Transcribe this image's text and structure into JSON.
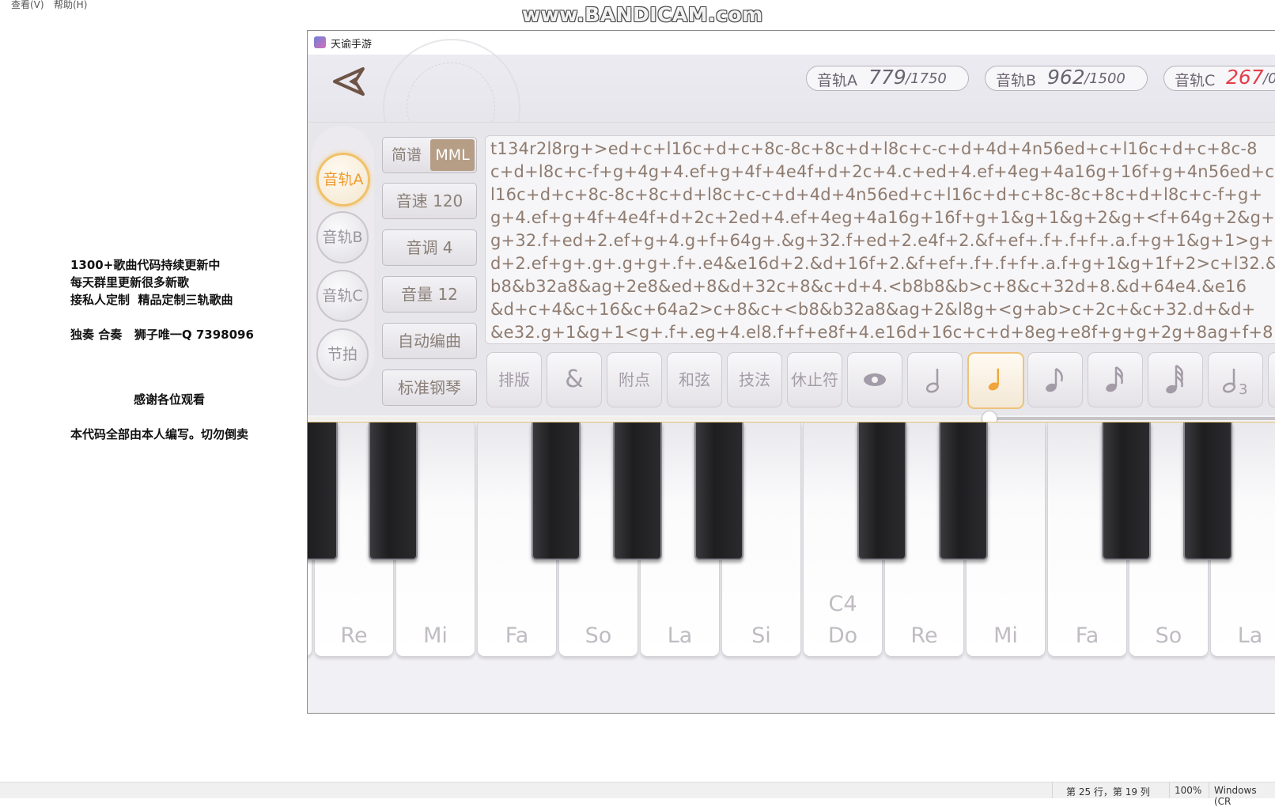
{
  "notepad": {
    "menu": [
      "查看(V)",
      "帮助(H)"
    ],
    "notes": {
      "line1": "1300+歌曲代码持续更新中",
      "line2": "每天群里更新很多新歌",
      "line3": "接私人定制  精品定制三轨歌曲",
      "line4": "独奏 合奏   狮子唯一Q 7398096",
      "line5": "感谢各位观看",
      "line6": "本代码全部由本人编写。切勿倒卖"
    },
    "status": {
      "position": "第 25 行，第 19 列",
      "zoom": "100%",
      "encoding": "Windows (CR"
    }
  },
  "watermark": "www.BANDICAM.com",
  "game": {
    "window_title": "天谕手游",
    "tracks": [
      {
        "label": "音轨A",
        "used": "779",
        "total": "/1750"
      },
      {
        "label": "音轨B",
        "used": "962",
        "total": "/1500"
      },
      {
        "label": "音轨C",
        "used": "267",
        "total": "/0"
      }
    ],
    "track_buttons": [
      "音轨A",
      "音轨B",
      "音轨C",
      "节拍"
    ],
    "active_track": "音轨A",
    "mode_toggle": {
      "simple": "简谱",
      "mml": "MML"
    },
    "controls": [
      "音速 120",
      "音调 4",
      "音量 12",
      "自动编曲",
      "标准钢琴"
    ],
    "code_lines": [
      "t134r2l8rg+>ed+c+l16c+d+c+8c-8c+8c+d+l8c+c-c+d+4d+4n56ed+c+l16c+d+c+8c-8",
      "c+d+l8c+c-f+g+4g+4.ef+g+4f+4e4f+d+2c+4.c+ed+4.ef+4eg+4a16g+16f+g+4n56ed+c",
      "l16c+d+c+8c-8c+8c+d+l8c+c-c+d+4d+4n56ed+c+l16c+d+c+8c-8c+8c+d+l8c+c-f+g+",
      "g+4.ef+g+4f+4e4f+d+2c+2ed+4.ef+4eg+4a16g+16f+g+1&g+1&g+2&g+<f+64g+2&g+",
      "g+32.f+ed+2.ef+g+4.g+f+64g+.&g+32.f+ed+2.e4f+2.&f+ef+.f+.f+f+.a.f+g+1&g+1>g+2",
      "d+2.ef+g+.g+.g+g+.f+.e4&e16d+2.&d+16f+2.&f+ef+.f+.f+f+.a.f+g+1&g+1f+2>c+l32.&",
      "b8&b32a8&ag+2e8&ed+8&d+32c+8&c+d+4.<b8b8&b>c+8&c+32d+8.&d+64e4.&e16",
      "&d+c+4&c+16&c+64a2>c+8&c+<b8&b32a8&ag+2&l8g+<g+ab>c+2c+&c+32.d+&d+",
      "&e32.g+1&g+1<g+.f+.eg+4.el8.f+f+e8f+4.e16d+16c+c+d+8eg+e8f+g+g+2g+8ag+f+8"
    ],
    "tools": [
      "排版",
      "&",
      "附点",
      "和弦",
      "技法",
      "休止符"
    ],
    "note_tool_icons": [
      "eye-icon",
      "half-note-icon",
      "quarter-note-icon",
      "eighth-note-icon",
      "sixteenth-note-icon",
      "thirty-second-note-icon",
      "triplet-note-icon"
    ],
    "triplet_sub": "3",
    "active_note_tool": "quarter-note-icon",
    "keys": [
      "Re",
      "Mi",
      "Fa",
      "So",
      "La",
      "Si",
      "Do",
      "Re",
      "Mi",
      "Fa",
      "So",
      "La"
    ],
    "octave_label": "C4",
    "colors": {
      "accent": "#ee9b2f",
      "mml_active": "#b59d86",
      "track_c_used": "#e53d4a"
    }
  }
}
